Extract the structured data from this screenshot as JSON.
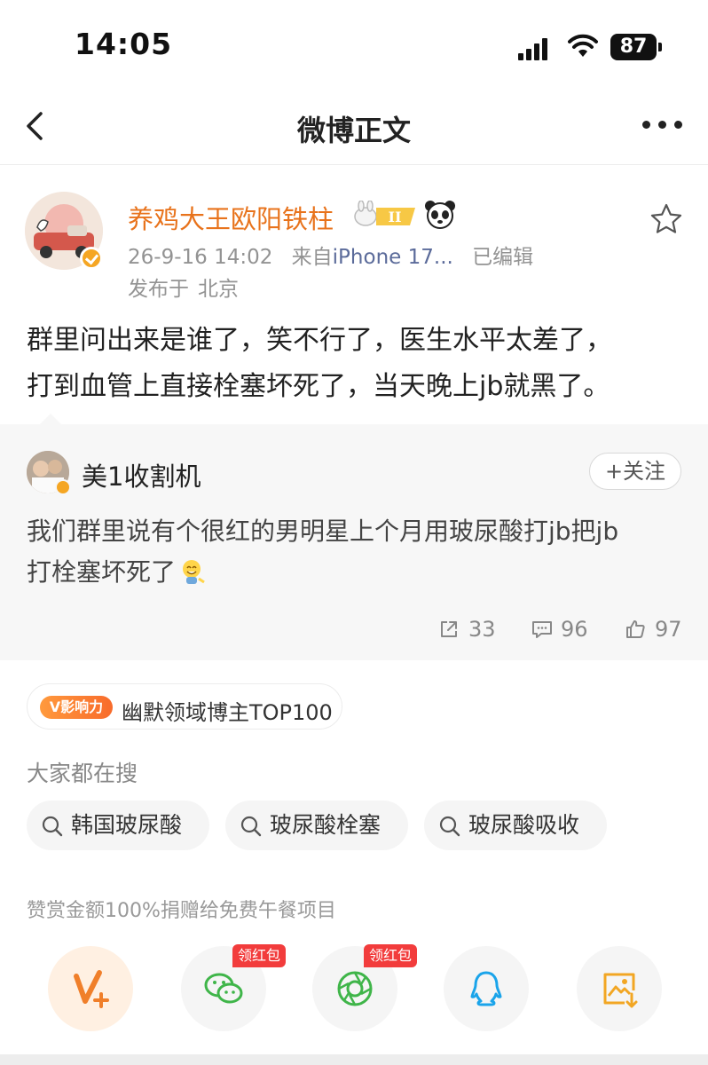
{
  "status_bar": {
    "time": "14:05",
    "battery": "87"
  },
  "nav": {
    "title": "微博正文"
  },
  "post": {
    "author": "养鸡大王欧阳铁柱",
    "time": "26-9-16 14:02",
    "source_prefix": "来自",
    "source": "iPhone 17...",
    "edited": "已编辑",
    "location_prefix": "发布于",
    "location": "北京",
    "text_lines": [
      "群里问出来是谁了，笑不行了，医生水平太差了，",
      "打到血管上直接栓塞坏死了，当天晚上jb就黑了。"
    ]
  },
  "repost": {
    "author": "美1收割机",
    "follow_label": "+关注",
    "text_lines": [
      "我们群里说有个很红的男明星上个月用玻尿酸打jb把jb",
      "打栓塞坏死了"
    ],
    "share_count": "33",
    "comment_count": "96",
    "like_count": "97"
  },
  "influence": {
    "tag": "V影响力",
    "text": "幽默领域博主TOP100"
  },
  "search": {
    "title": "大家都在搜",
    "chips": [
      "韩国玻尿酸",
      "玻尿酸栓塞",
      "玻尿酸吸收"
    ]
  },
  "reward_text": "赞赏金额100%捐赠给免费午餐项目",
  "share_row": {
    "red_tags": [
      "领红包",
      "领红包"
    ],
    "icons": [
      "vplus-icon",
      "wechat-icon",
      "moments-icon",
      "qq-icon",
      "save-image-icon"
    ]
  },
  "colors": {
    "author_orange": "#e8731c",
    "source_blue": "#5b6b9a",
    "red_tag": "#f23c3c",
    "card_bg": "#f7f7f7"
  }
}
